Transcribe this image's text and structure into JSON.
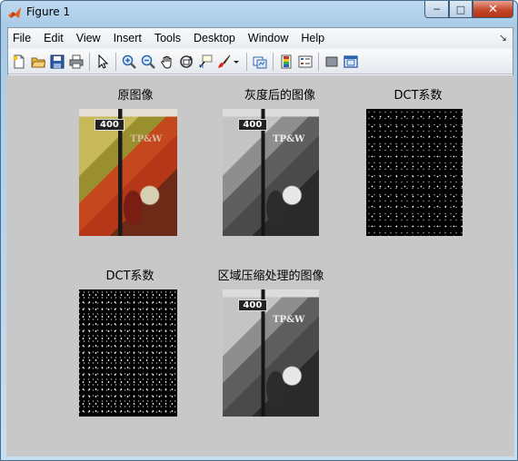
{
  "window": {
    "title": "Figure 1",
    "minimize_glyph": "─",
    "maximize_glyph": "□",
    "close_glyph": "✕"
  },
  "menubar": {
    "items": [
      "File",
      "Edit",
      "View",
      "Insert",
      "Tools",
      "Desktop",
      "Window",
      "Help"
    ],
    "overflow_glyph": "↘"
  },
  "toolbar": {
    "icons": [
      "new-figure-icon",
      "open-file-icon",
      "save-icon",
      "print-icon",
      "edit-plot-arrow-icon",
      "zoom-in-icon",
      "zoom-out-icon",
      "pan-hand-icon",
      "rotate-3d-icon",
      "data-cursor-icon",
      "brush-icon",
      "brush-dropdown-icon",
      "link-plot-icon",
      "insert-colorbar-icon",
      "insert-legend-icon",
      "hide-plot-tools-icon",
      "show-plot-tools-icon"
    ]
  },
  "figure": {
    "background": "#c8c8c8",
    "axes": [
      {
        "title": "原图像",
        "kind": "color-photo",
        "plate": "400",
        "logo": "TP&W"
      },
      {
        "title": "灰度后的图像",
        "kind": "grayscale-photo",
        "plate": "400",
        "logo": "TP&W"
      },
      {
        "title": "DCT系数",
        "kind": "dct-coefficients"
      },
      {
        "title": "DCT系数",
        "kind": "dct-coefficients"
      },
      {
        "title": "区域压缩处理的图像",
        "kind": "grayscale-photo",
        "plate": "400",
        "logo": "TP&W"
      }
    ]
  }
}
